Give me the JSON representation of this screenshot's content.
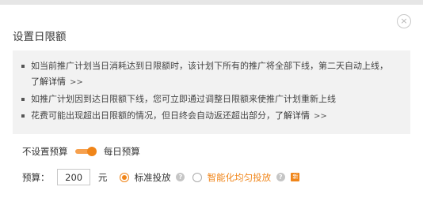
{
  "dialog": {
    "title": "设置日限额",
    "close_icon": "×"
  },
  "tips": [
    {
      "text": "如当前推广计划当日消耗达到日限额时，该计划下所有的推广将全部下线，第二天自动上线，",
      "link": "了解详情",
      "arrow": ">>"
    },
    {
      "text": "如推广计划因到达日限额下线，您可立即通过调整日限额来使推广计划重新上线",
      "link": "",
      "arrow": ""
    },
    {
      "text": "花费可能出现超出日限额的情况，但日终会自动返还超出部分，",
      "link": "了解详情",
      "arrow": ">>"
    }
  ],
  "budget_toggle": {
    "off_label": "不设置预算",
    "on_label": "每日预算",
    "state": "on"
  },
  "budget": {
    "label": "预算：",
    "value": "200",
    "unit": "元"
  },
  "delivery_options": [
    {
      "label": "标准投放",
      "checked": true
    },
    {
      "label": "智能化均匀投放",
      "checked": false
    }
  ],
  "help_icon": "?",
  "new_badge": "新",
  "colors": {
    "accent": "#f08519",
    "tips_bg": "#f2f2f2"
  }
}
